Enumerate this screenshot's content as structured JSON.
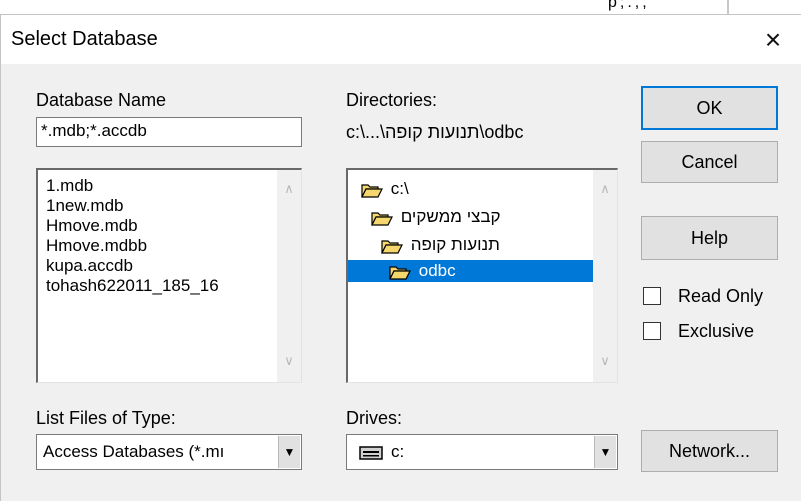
{
  "window": {
    "title": "Select Database",
    "close_glyph": "×"
  },
  "top_fragment": "p;.,,",
  "database_name": {
    "label": "Database Name",
    "value": "*.mdb;*.accdb",
    "files": [
      "1.mdb",
      "1new.mdb",
      "Hmove.mdb",
      "Hmove.mdbb",
      "kupa.accdb",
      "tohash622011_185_16"
    ]
  },
  "directories": {
    "label": "Directories:",
    "current_path": "c:\\...\\תנועות קופה\\odbc",
    "items": [
      {
        "name": "c:\\",
        "icon": "open-folder-icon"
      },
      {
        "name": "קבצי ממשקים",
        "icon": "open-folder-icon"
      },
      {
        "name": "תנועות קופה",
        "icon": "open-folder-icon"
      },
      {
        "name": "odbc",
        "icon": "open-folder-icon",
        "selected": true
      }
    ]
  },
  "file_type": {
    "label": "List Files of Type:",
    "value": "Access Databases (*.mı"
  },
  "drives": {
    "label": "Drives:",
    "value": "c:",
    "icon": "drive-icon"
  },
  "buttons": {
    "ok": "OK",
    "cancel": "Cancel",
    "help": "Help",
    "network": "Network..."
  },
  "options": {
    "read_only": "Read Only",
    "exclusive": "Exclusive",
    "read_only_checked": false,
    "exclusive_checked": false
  },
  "scroll": {
    "up": "∧",
    "down": "∨",
    "dropdown": "▼"
  },
  "colors": {
    "selection": "#0078d7",
    "dialog_bg": "#f0f0f0",
    "folder": "#f5d76e"
  }
}
